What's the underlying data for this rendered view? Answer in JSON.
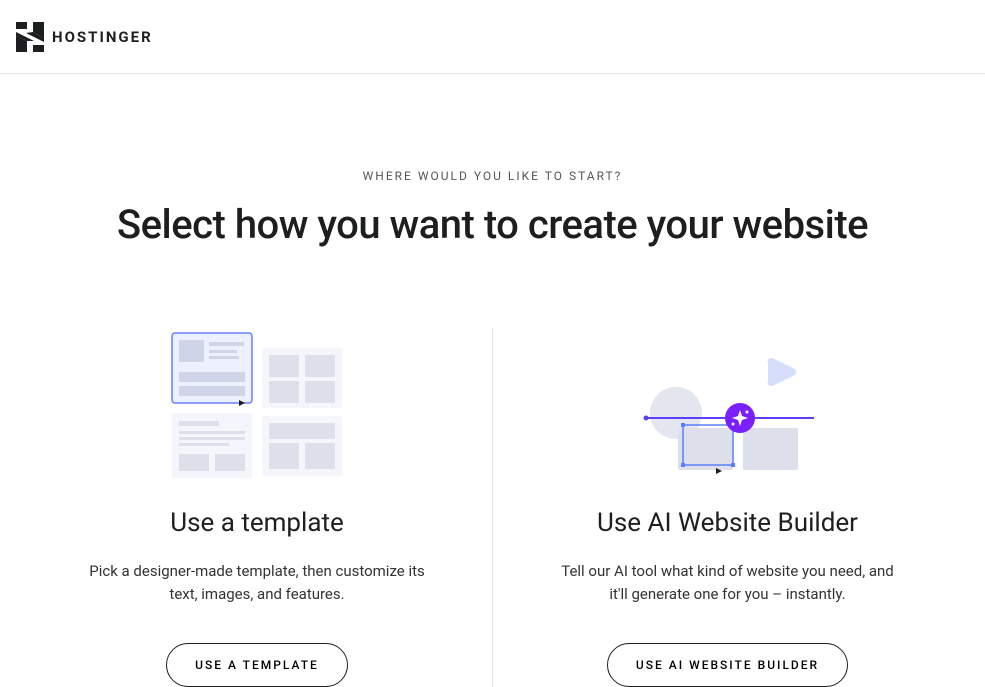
{
  "header": {
    "brand": "HOSTINGER"
  },
  "main": {
    "eyebrow": "WHERE WOULD YOU LIKE TO START?",
    "title": "Select how you want to create your website",
    "options": {
      "template": {
        "title": "Use a template",
        "description": "Pick a designer-made template, then customize its text, images, and features.",
        "button": "USE A TEMPLATE"
      },
      "ai": {
        "title": "Use AI Website Builder",
        "description": "Tell our AI tool what kind of website you need, and it'll generate one for you – instantly.",
        "button": "USE AI WEBSITE BUILDER"
      }
    }
  }
}
